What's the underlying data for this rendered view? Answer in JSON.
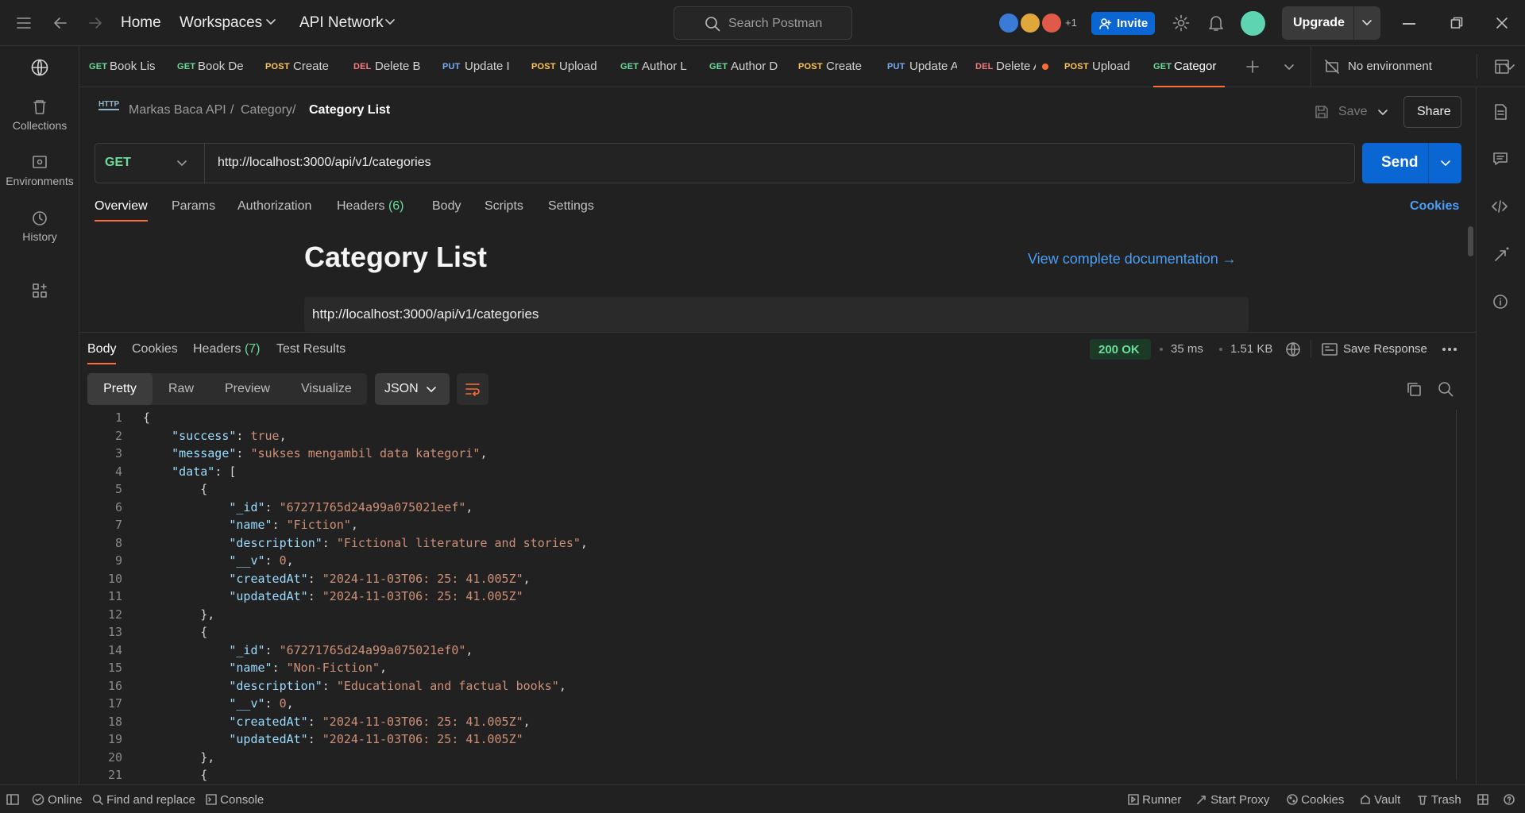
{
  "topbar": {
    "home": "Home",
    "workspaces": "Workspaces",
    "api_network": "API Network",
    "search_placeholder": "Search Postman",
    "avatars_extra": "+1",
    "invite": "Invite",
    "upgrade": "Upgrade"
  },
  "tabs": [
    {
      "method": "GET",
      "name": "Book Lis"
    },
    {
      "method": "GET",
      "name": "Book De"
    },
    {
      "method": "POST",
      "name": "Create"
    },
    {
      "method": "DEL",
      "name": "Delete B"
    },
    {
      "method": "PUT",
      "name": "Update I"
    },
    {
      "method": "POST",
      "name": "Upload"
    },
    {
      "method": "GET",
      "name": "Author L"
    },
    {
      "method": "GET",
      "name": "Author D"
    },
    {
      "method": "POST",
      "name": "Create"
    },
    {
      "method": "PUT",
      "name": "Update A"
    },
    {
      "method": "DEL",
      "name": "Delete A"
    },
    {
      "method": "POST",
      "name": "Upload"
    },
    {
      "method": "GET",
      "name": "Categor"
    }
  ],
  "environment": "No environment",
  "sidebar": {
    "collections": "Collections",
    "environments": "Environments",
    "history": "History"
  },
  "breadcrumb": {
    "collection": "Markas Baca API",
    "folder": "Category",
    "current": "Category List",
    "sep": "/"
  },
  "actions": {
    "save": "Save",
    "share": "Share"
  },
  "request": {
    "method": "GET",
    "url": "http://localhost:3000/api/v1/categories",
    "send": "Send"
  },
  "request_tabs": {
    "overview": "Overview",
    "params": "Params",
    "authorization": "Authorization",
    "headers": "Headers",
    "headers_count": "(6)",
    "body": "Body",
    "scripts": "Scripts",
    "settings": "Settings",
    "cookies": "Cookies"
  },
  "docs": {
    "title": "Category List",
    "view_docs": "View complete documentation →",
    "url": "http://localhost:3000/api/v1/categories"
  },
  "response_tabs": {
    "body": "Body",
    "cookies": "Cookies",
    "headers": "Headers",
    "headers_count": "(7)",
    "test_results": "Test Results"
  },
  "response_meta": {
    "status": "200 OK",
    "time": "35 ms",
    "size": "1.51 KB",
    "save_response": "Save Response"
  },
  "format": {
    "pretty": "Pretty",
    "raw": "Raw",
    "preview": "Preview",
    "visualize": "Visualize",
    "lang": "JSON"
  },
  "code_lines": [
    "{",
    "    \"success\": true,",
    "    \"message\": \"sukses mengambil data kategori\",",
    "    \"data\": [",
    "        {",
    "            \"_id\": \"67271765d24a99a075021eef\",",
    "            \"name\": \"Fiction\",",
    "            \"description\": \"Fictional literature and stories\",",
    "            \"__v\": 0,",
    "            \"createdAt\": \"2024-11-03T06:25:41.005Z\",",
    "            \"updatedAt\": \"2024-11-03T06:25:41.005Z\"",
    "        },",
    "        {",
    "            \"_id\": \"67271765d24a99a075021ef0\",",
    "            \"name\": \"Non-Fiction\",",
    "            \"description\": \"Educational and factual books\",",
    "            \"__v\": 0,",
    "            \"createdAt\": \"2024-11-03T06:25:41.005Z\",",
    "            \"updatedAt\": \"2024-11-03T06:25:41.005Z\"",
    "        },",
    "        {"
  ],
  "statusbar": {
    "online": "Online",
    "find_replace": "Find and replace",
    "console": "Console",
    "runner": "Runner",
    "start_proxy": "Start Proxy",
    "cookies": "Cookies",
    "vault": "Vault",
    "trash": "Trash"
  },
  "colors": {
    "accent": "#ff6c37",
    "primary": "#0a66d2",
    "get": "#6bdd9a",
    "post": "#ffc758",
    "del": "#f57a7a",
    "put": "#74aef6"
  }
}
